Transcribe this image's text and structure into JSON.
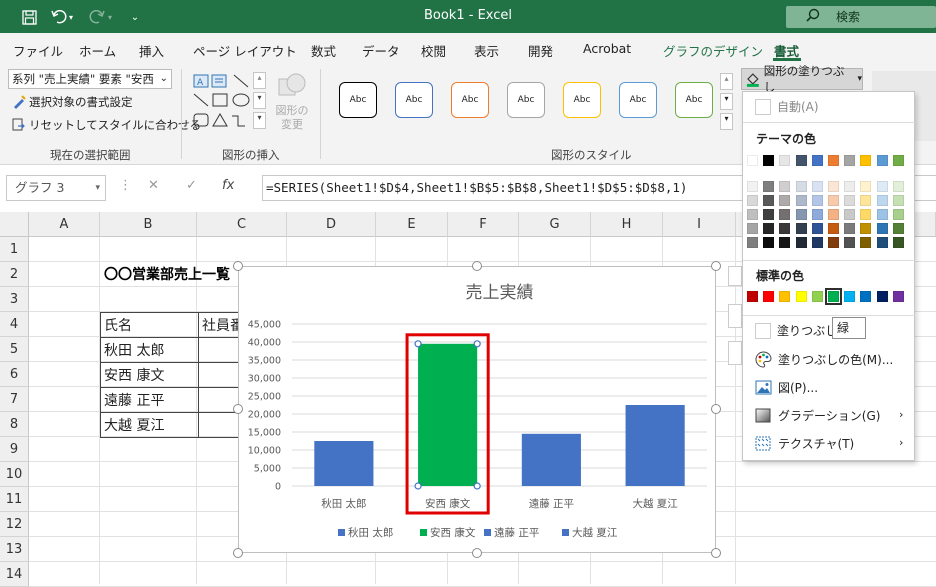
{
  "app": {
    "title": "Book1  -  Excel",
    "search_label": "検索"
  },
  "tabs": [
    "ファイル",
    "ホーム",
    "挿入",
    "ページ レイアウト",
    "数式",
    "データ",
    "校閲",
    "表示",
    "開発",
    "Acrobat",
    "グラフのデザイン",
    "書式"
  ],
  "ribbon": {
    "series_select": "系列 \"売上実績\" 要素 \"安西",
    "format_selection": "選択対象の書式設定",
    "reset_style": "リセットしてスタイルに合わせる",
    "group_current_selection": "現在の選択範囲",
    "group_insert_shapes": "図形の挿入",
    "group_shape_styles": "図形のスタイル",
    "change_shape": "図形の\n変更",
    "style_sample": "Abc",
    "fill_button": "図形の塗りつぶし",
    "style_colors": [
      "#000000",
      "#4472c4",
      "#ed7d31",
      "#a5a5a5",
      "#ffc000",
      "#5b9bd5",
      "#70ad47"
    ]
  },
  "formula_bar": {
    "name_box": "グラフ 3",
    "formula": "=SERIES(Sheet1!$D$4,Sheet1!$B$5:$B$8,Sheet1!$D$5:$D$8,1)"
  },
  "sheet": {
    "columns": [
      "A",
      "B",
      "C",
      "D",
      "E",
      "F",
      "G",
      "H",
      "I"
    ],
    "rows": [
      "1",
      "2",
      "3",
      "4",
      "5",
      "6",
      "7",
      "8",
      "9",
      "10",
      "11",
      "12",
      "13",
      "14"
    ],
    "title_cell": "〇〇営業部売上一覧",
    "header_name": "氏名",
    "header_id": "社員番",
    "names": [
      "秋田 太郎",
      "安西 康文",
      "遠藤 正平",
      "大越 夏江"
    ]
  },
  "chart_data": {
    "type": "bar",
    "title": "売上実績",
    "categories": [
      "秋田 太郎",
      "安西 康文",
      "遠藤 正平",
      "大越 夏江"
    ],
    "values": [
      12500,
      39500,
      14500,
      22500
    ],
    "ylim": [
      0,
      45000
    ],
    "yticks": [
      "45,000",
      "40,000",
      "35,000",
      "30,000",
      "25,000",
      "20,000",
      "15,000",
      "10,000",
      "5,000",
      "0"
    ],
    "bar_colors": [
      "#4472c4",
      "#00b050",
      "#4472c4",
      "#4472c4"
    ],
    "legend_placement": "bottom",
    "grid": true,
    "selected_index": 1
  },
  "fill_menu": {
    "auto": "自動(A)",
    "theme_colors_header": "テーマの色",
    "standard_colors_header": "標準の色",
    "no_fill": "塗りつぶしなし",
    "more_colors": "塗りつぶしの色(M)...",
    "picture": "図(P)...",
    "gradient": "グラデーション(G)",
    "texture": "テクスチャ(T)",
    "tooltip": "緑",
    "theme_row": [
      "#ffffff",
      "#000000",
      "#e7e6e6",
      "#44546a",
      "#4472c4",
      "#ed7d31",
      "#a5a5a5",
      "#ffc000",
      "#5b9bd5",
      "#70ad47"
    ],
    "theme_shades": [
      [
        "#f2f2f2",
        "#7f7f7f",
        "#d0cece",
        "#d6dce4",
        "#d9e2f3",
        "#fbe5d5",
        "#ededed",
        "#fff2cc",
        "#ddebf7",
        "#e2efd9"
      ],
      [
        "#d9d9d9",
        "#595959",
        "#aeaaaa",
        "#adb9ca",
        "#b4c6e7",
        "#f7caac",
        "#dbdbdb",
        "#fee599",
        "#bdd7ee",
        "#c5e0b3"
      ],
      [
        "#bfbfbf",
        "#3f3f3f",
        "#757070",
        "#8496b0",
        "#8eaadb",
        "#f4b183",
        "#c9c9c9",
        "#ffd965",
        "#9cc3e5",
        "#a8d08d"
      ],
      [
        "#a5a5a5",
        "#262626",
        "#3a3838",
        "#323f4f",
        "#2f5496",
        "#c55a11",
        "#7b7b7b",
        "#bf9000",
        "#2e75b5",
        "#538135"
      ],
      [
        "#7f7f7f",
        "#0d0d0d",
        "#171616",
        "#222a35",
        "#1f3864",
        "#833c0b",
        "#525252",
        "#7f6000",
        "#1e4e79",
        "#375623"
      ]
    ],
    "standard_row": [
      "#c00000",
      "#ff0000",
      "#ffc000",
      "#ffff00",
      "#92d050",
      "#00b050",
      "#00b0f0",
      "#0070c0",
      "#002060",
      "#7030a0"
    ]
  }
}
